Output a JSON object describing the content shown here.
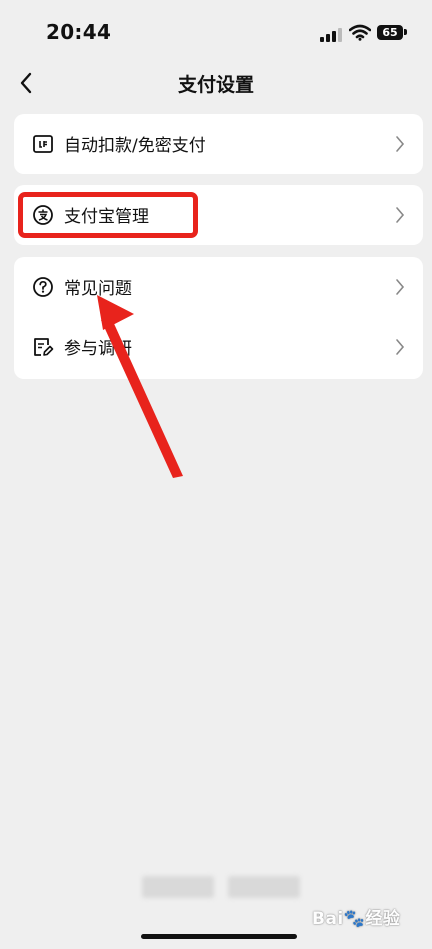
{
  "status_bar": {
    "time": "20:44",
    "battery": "65"
  },
  "nav": {
    "title": "支付设置"
  },
  "menu": {
    "auto_pay": "自动扣款/免密支付",
    "alipay_manage": "支付宝管理",
    "faq": "常见问题",
    "survey": "参与调研"
  },
  "watermark": "Bai🐾经验",
  "colors": {
    "highlight": "#e8231c",
    "background": "#efefef",
    "card": "#ffffff"
  }
}
